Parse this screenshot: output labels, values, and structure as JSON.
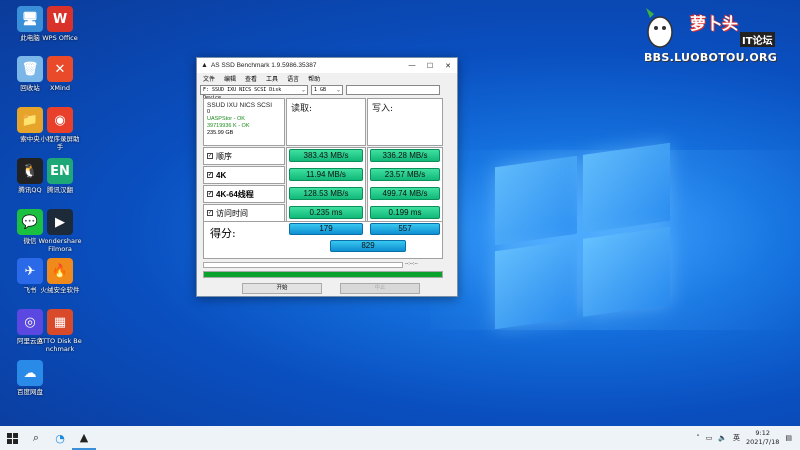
{
  "desktop": {
    "icons": [
      {
        "label": "此电脑",
        "icon": "computer-icon",
        "color": "#3a8fd8",
        "glyph": "🖥"
      },
      {
        "label": "回收站",
        "icon": "recycle-bin-icon",
        "color": "#7ab6e8",
        "glyph": "🗑"
      },
      {
        "label": "索中央",
        "icon": "folder-icon",
        "color": "#e6a52a",
        "glyph": "📁"
      },
      {
        "label": "腾讯QQ",
        "icon": "qq-icon",
        "color": "#222222",
        "glyph": "🐧"
      },
      {
        "label": "微信",
        "icon": "wechat-icon",
        "color": "#1bc040",
        "glyph": "💬"
      },
      {
        "label": "飞书",
        "icon": "feishu-icon",
        "color": "#2a6ae8",
        "glyph": "✈"
      },
      {
        "label": "阿里云盘",
        "icon": "aliyun-drive-icon",
        "color": "#5a48e0",
        "glyph": "◎"
      },
      {
        "label": "百度网盘",
        "icon": "baidu-drive-icon",
        "color": "#2a8ae8",
        "glyph": "☁"
      },
      {
        "label": "WPS Office",
        "icon": "wps-icon",
        "color": "#d9322b",
        "glyph": "W"
      },
      {
        "label": "XMind",
        "icon": "xmind-icon",
        "color": "#e84a2a",
        "glyph": "✕"
      },
      {
        "label": "小程序录屏助手",
        "icon": "screen-recorder-icon",
        "color": "#e8402a",
        "glyph": "◉"
      },
      {
        "label": "腾讯汉翻",
        "icon": "translator-icon",
        "color": "#1ea878",
        "glyph": "EN"
      },
      {
        "label": "Wondershare Filmora",
        "icon": "filmora-icon",
        "color": "#1d2a3a",
        "glyph": "▶"
      },
      {
        "label": "火绒安全软件",
        "icon": "huorong-icon",
        "color": "#f08a1a",
        "glyph": "🔥"
      },
      {
        "label": "ATTO Disk Benchmark",
        "icon": "atto-icon",
        "color": "#d84a2a",
        "glyph": "▦"
      }
    ]
  },
  "watermark": {
    "title": "萝卜头",
    "subtitle": "IT论坛",
    "url": "BBS.LUOBOTOU.ORG"
  },
  "window": {
    "title": "AS SSD Benchmark 1.9.5986.35387",
    "menu": [
      "文件",
      "编辑",
      "查看",
      "工具",
      "语言",
      "帮助"
    ],
    "drive_select": "F: SSUD IXU NICS SCSI Disk Device",
    "size_select": "1 GB",
    "drive_info": {
      "name": "SSUD IXU NICS SCSI",
      "line2": "0",
      "line3": "UASPStor - OK",
      "line4": "39719936 K - OK",
      "line5": "235.99 GB"
    },
    "read_header": "读取:",
    "write_header": "写入:",
    "rows": [
      {
        "label": "顺序",
        "read": "383.43 MB/s",
        "write": "336.28 MB/s"
      },
      {
        "label": "4K",
        "read": "11.94 MB/s",
        "write": "23.57 MB/s"
      },
      {
        "label": "4K-64线程",
        "read": "128.53 MB/s",
        "write": "499.74 MB/s"
      },
      {
        "label": "访问时间",
        "read": "0.235 ms",
        "write": "0.199 ms"
      }
    ],
    "score_label": "得分:",
    "score_read": "179",
    "score_write": "557",
    "score_total": "829",
    "progress_fraction": 1.0,
    "time_text": "--:--:--",
    "start_button": "开始",
    "abort_button": "中止"
  },
  "taskbar": {
    "ime": "英",
    "time": "9:12",
    "date": "2021/7/18"
  }
}
